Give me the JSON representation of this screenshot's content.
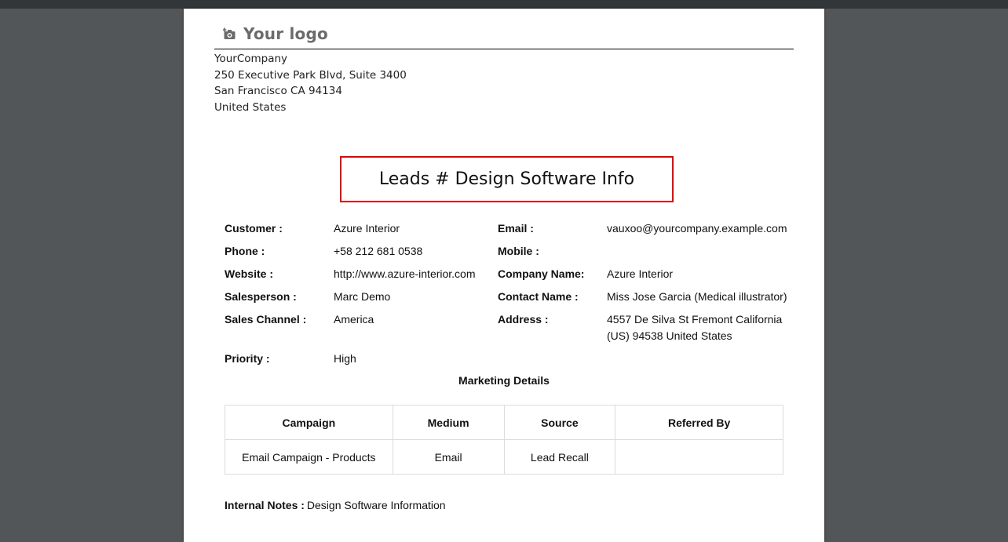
{
  "company": {
    "logo_text": "Your logo",
    "name": "YourCompany",
    "street": "250 Executive Park Blvd, Suite 3400",
    "city": "San Francisco CA 94134",
    "country": "United States"
  },
  "title": "Leads # Design Software Info",
  "fields": {
    "customer": {
      "label": "Customer :",
      "value": "Azure Interior"
    },
    "phone": {
      "label": "Phone :",
      "value": "+58 212 681 0538"
    },
    "website": {
      "label": "Website :",
      "value": "http://www.azure-interior.com"
    },
    "salesperson": {
      "label": "Salesperson :",
      "value": "Marc Demo"
    },
    "sales_channel": {
      "label": "Sales Channel :",
      "value": "America"
    },
    "priority": {
      "label": "Priority :",
      "value": "High"
    },
    "email": {
      "label": "Email :",
      "value": "vauxoo@yourcompany.example.com"
    },
    "mobile": {
      "label": "Mobile :",
      "value": ""
    },
    "company_name": {
      "label": "Company Name:",
      "value": "Azure Interior"
    },
    "contact_name": {
      "label": "Contact Name :",
      "value": "Miss Jose Garcia (Medical illustrator)"
    },
    "address": {
      "label": "Address :",
      "value": "4557 De Silva St Fremont California (US) 94538 United States"
    }
  },
  "marketing": {
    "title": "Marketing Details",
    "columns": [
      "Campaign",
      "Medium",
      "Source",
      "Referred By"
    ],
    "row": [
      "Email Campaign - Products",
      "Email",
      "Lead Recall",
      ""
    ]
  },
  "notes": {
    "label": "Internal Notes :",
    "value": "Design Software Information"
  },
  "colors": {
    "viewer_bg": "#525659",
    "title_border": "#e00000",
    "logo": "#6b6b6b"
  },
  "icons": {
    "logo": "camera-icon"
  }
}
